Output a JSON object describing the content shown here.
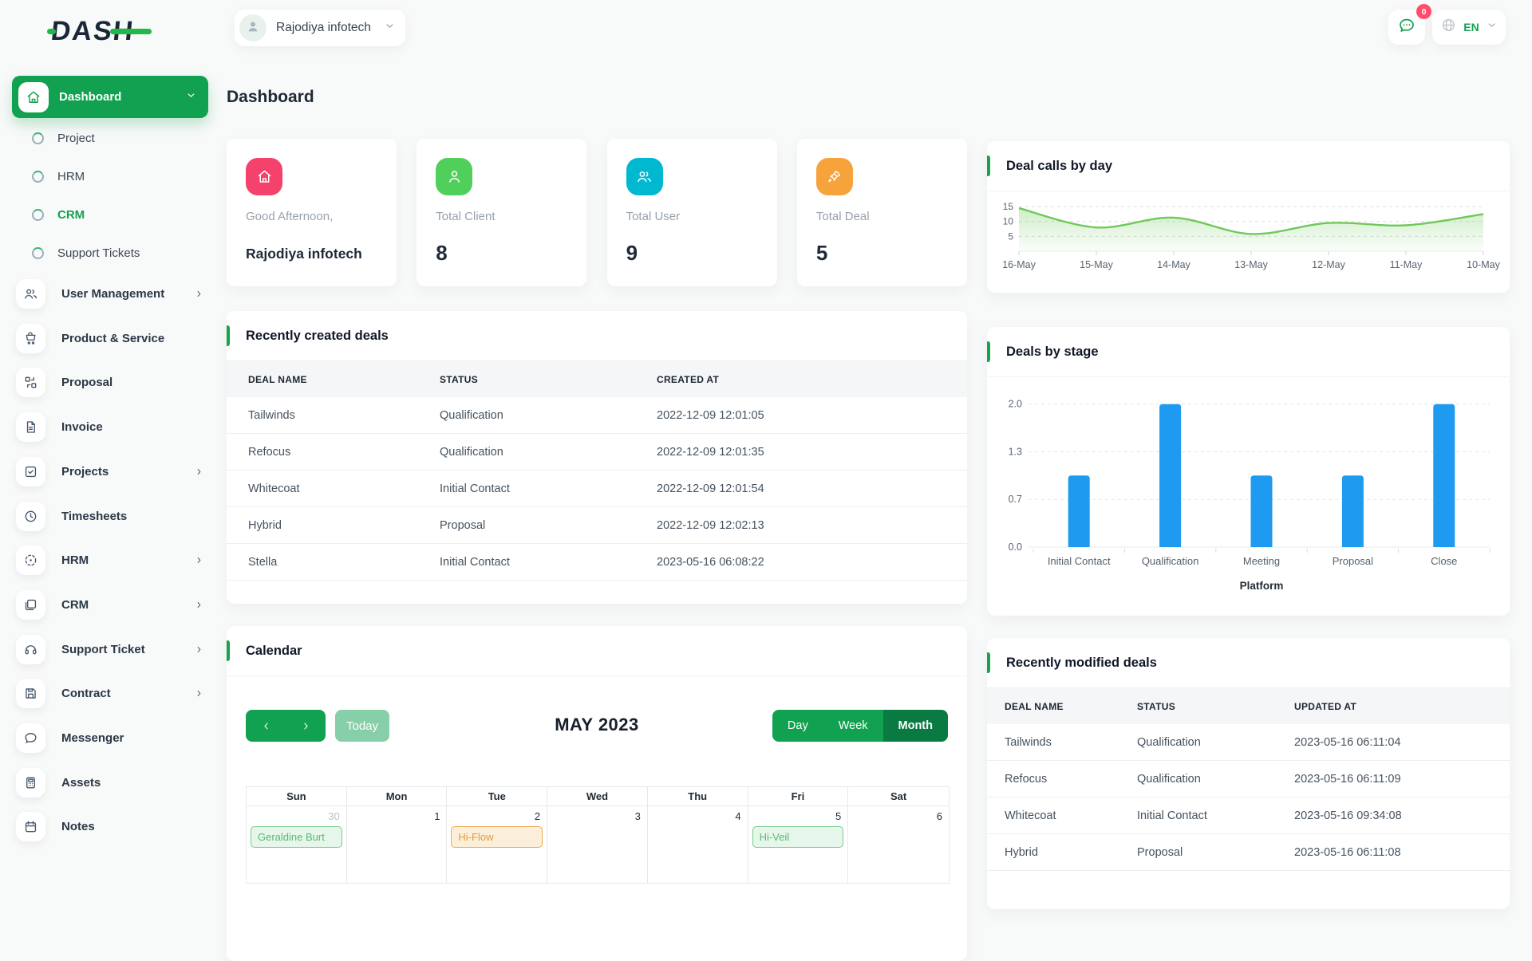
{
  "brand": {
    "logo_text": "DASH"
  },
  "topbar": {
    "company": "Rajodiya infotech",
    "messages_badge": "0",
    "language": "EN"
  },
  "page": {
    "title": "Dashboard"
  },
  "theme": {
    "primary_green": "#12a150",
    "active_view_green": "#0a7a43",
    "today_green": "#87cfa8",
    "accent_bar_green": "#16a34a",
    "badge_red": "#ff4d6b",
    "bar_blue": "#1e9bf0",
    "line_green": "#6fc95a"
  },
  "sidebar": {
    "items": [
      {
        "label": "Dashboard",
        "icon": "home",
        "type": "active",
        "chevron": "down"
      },
      {
        "label": "Project",
        "type": "sub"
      },
      {
        "label": "HRM",
        "type": "sub"
      },
      {
        "label": "CRM",
        "type": "sub",
        "active": true
      },
      {
        "label": "Support Tickets",
        "type": "sub"
      },
      {
        "label": "User Management",
        "icon": "users",
        "chevron": "right"
      },
      {
        "label": "Product & Service",
        "icon": "cart"
      },
      {
        "label": "Proposal",
        "icon": "swap"
      },
      {
        "label": "Invoice",
        "icon": "file"
      },
      {
        "label": "Projects",
        "icon": "check-square",
        "chevron": "right"
      },
      {
        "label": "Timesheets",
        "icon": "clock"
      },
      {
        "label": "HRM",
        "icon": "target",
        "chevron": "right"
      },
      {
        "label": "CRM",
        "icon": "cards",
        "chevron": "right"
      },
      {
        "label": "Support Ticket",
        "icon": "headset",
        "chevron": "right"
      },
      {
        "label": "Contract",
        "icon": "floppy",
        "chevron": "right"
      },
      {
        "label": "Messenger",
        "icon": "chat"
      },
      {
        "label": "Assets",
        "icon": "calculator"
      },
      {
        "label": "Notes",
        "icon": "calendar"
      }
    ]
  },
  "stat_cards": [
    {
      "icon": "home",
      "color": "#f4426c",
      "label": "Good Afternoon,",
      "value": "Rajodiya infotech",
      "style": "name"
    },
    {
      "icon": "user",
      "color": "#50d05a",
      "label": "Total Client",
      "value": "8"
    },
    {
      "icon": "users",
      "color": "#00b9d1",
      "label": "Total User",
      "value": "9"
    },
    {
      "icon": "rocket",
      "color": "#f6a33c",
      "label": "Total Deal",
      "value": "5"
    }
  ],
  "recent_created": {
    "title": "Recently created deals",
    "columns": [
      "DEAL NAME",
      "STATUS",
      "CREATED AT"
    ],
    "rows": [
      [
        "Tailwinds",
        "Qualification",
        "2022-12-09 12:01:05"
      ],
      [
        "Refocus",
        "Qualification",
        "2022-12-09 12:01:35"
      ],
      [
        "Whitecoat",
        "Initial Contact",
        "2022-12-09 12:01:54"
      ],
      [
        "Hybrid",
        "Proposal",
        "2022-12-09 12:02:13"
      ],
      [
        "Stella",
        "Initial Contact",
        "2023-05-16 06:08:22"
      ]
    ]
  },
  "recent_modified": {
    "title": "Recently modified deals",
    "columns": [
      "DEAL NAME",
      "STATUS",
      "UPDATED AT"
    ],
    "rows": [
      [
        "Tailwinds",
        "Qualification",
        "2023-05-16 06:11:04"
      ],
      [
        "Refocus",
        "Qualification",
        "2023-05-16 06:11:09"
      ],
      [
        "Whitecoat",
        "Initial Contact",
        "2023-05-16 09:34:08"
      ],
      [
        "Hybrid",
        "Proposal",
        "2023-05-16 06:11:08"
      ]
    ]
  },
  "calendar": {
    "title": "Calendar",
    "nav": {
      "today": "Today"
    },
    "month_title": "MAY 2023",
    "views": [
      {
        "label": "Day",
        "active": false
      },
      {
        "label": "Week",
        "active": false
      },
      {
        "label": "Month",
        "active": true
      }
    ],
    "day_headers": [
      "Sun",
      "Mon",
      "Tue",
      "Wed",
      "Thu",
      "Fri",
      "Sat"
    ],
    "weeks": [
      [
        {
          "num": "30",
          "muted": true,
          "event": {
            "label": "Geraldine Burt",
            "variant": "green"
          }
        },
        {
          "num": "1"
        },
        {
          "num": "2",
          "event": {
            "label": "Hi-Flow",
            "variant": "orange"
          }
        },
        {
          "num": "3"
        },
        {
          "num": "4"
        },
        {
          "num": "5",
          "event": {
            "label": "Hi-Veil",
            "variant": "green"
          }
        },
        {
          "num": "6"
        }
      ]
    ]
  },
  "chart_data": [
    {
      "type": "area",
      "title": "Deal calls by day",
      "x": [
        "16-May",
        "15-May",
        "14-May",
        "13-May",
        "12-May",
        "11-May",
        "10-May"
      ],
      "values": [
        14.5,
        8,
        11.3,
        5.8,
        9.5,
        8.7,
        12.5
      ],
      "yticks": [
        {
          "v": 5,
          "label": "5"
        },
        {
          "v": 10,
          "label": "10"
        },
        {
          "v": 15,
          "label": "15"
        }
      ],
      "ylim": [
        0,
        16
      ],
      "grid": "dashed",
      "line_color": "#6fc95a",
      "legend": "none"
    },
    {
      "type": "bar",
      "title": "Deals by stage",
      "categories": [
        "Initial Contact",
        "Qualification",
        "Meeting",
        "Proposal",
        "Close"
      ],
      "values": [
        1,
        2,
        1,
        1,
        2
      ],
      "yticks": [
        {
          "v": 0,
          "label": "0.0"
        },
        {
          "v": 0.6667,
          "label": "0.7"
        },
        {
          "v": 1.3333,
          "label": "1.3"
        },
        {
          "v": 2,
          "label": "2.0"
        }
      ],
      "ylim": [
        0,
        2.03
      ],
      "xlabel": "Platform",
      "grid": "dashed",
      "bar_color": "#1e9bf0",
      "legend": "none"
    }
  ]
}
